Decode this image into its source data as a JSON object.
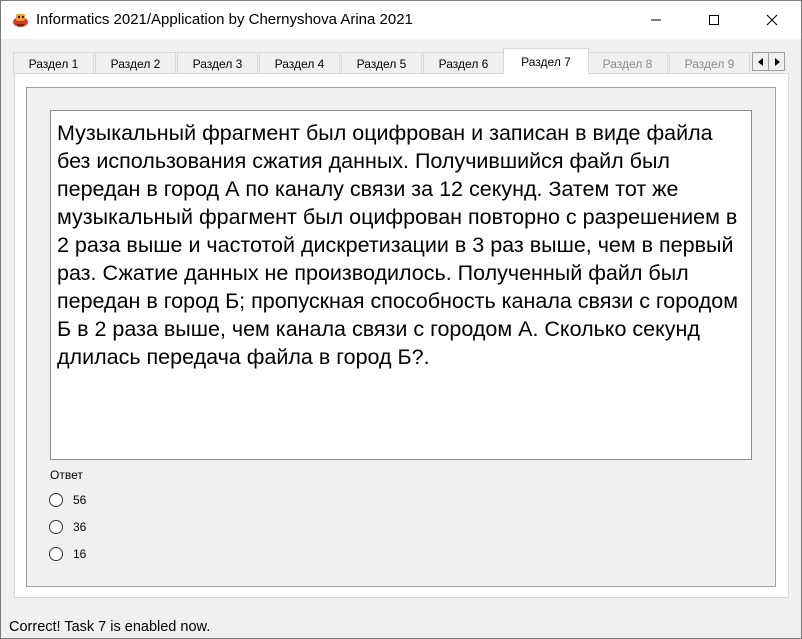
{
  "window": {
    "title": "Informatics 2021/Application by Chernyshova Arina 2021",
    "icon": "app-icon",
    "controls": [
      "minimize-icon",
      "maximize-icon",
      "close-icon"
    ]
  },
  "tabs": [
    {
      "label": "Раздел 1",
      "state": "enabled"
    },
    {
      "label": "Раздел 2",
      "state": "enabled"
    },
    {
      "label": "Раздел 3",
      "state": "enabled"
    },
    {
      "label": "Раздел 4",
      "state": "enabled"
    },
    {
      "label": "Раздел 5",
      "state": "enabled"
    },
    {
      "label": "Раздел 6",
      "state": "enabled"
    },
    {
      "label": "Раздел 7",
      "state": "active"
    },
    {
      "label": "Раздел 8",
      "state": "disabled"
    },
    {
      "label": "Раздел 9",
      "state": "disabled"
    }
  ],
  "tab_scroll": {
    "left_icon": "arrow-left-icon",
    "right_icon": "arrow-right-icon"
  },
  "question": {
    "text": "Музыкальный фрагмент был оцифрован и записан в виде файла без использования сжатия данных. Получившийся файл был передан в город А по каналу связи за 12 секунд. Затем тот же музыкальный фрагмент был оцифрован повторно с разрешением в 2 раза выше и частотой дискретизации в 3 раз выше, чем в первый раз. Сжатие данных не производилось. Полученный файл был передан в город Б; пропускная способность канала связи с городом Б в 2 раза выше, чем канала связи с городом А. Сколько секунд длилась передача файла в город Б?."
  },
  "answer": {
    "label": "Ответ",
    "options": [
      "56",
      "36",
      "16"
    ]
  },
  "status": {
    "text": "Correct! Task 7 is enabled now."
  }
}
